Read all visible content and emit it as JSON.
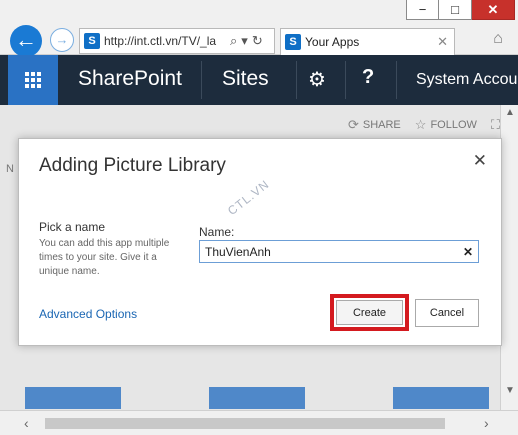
{
  "browser": {
    "address_url": "http://int.ctl.vn/TV/_la",
    "tab_title": "Your Apps",
    "window_min": "−",
    "window_max": "□",
    "window_close": "✕"
  },
  "suite_bar": {
    "brand": "SharePoint",
    "sites": "Sites",
    "help": "?",
    "account": "System Accou"
  },
  "page_actions": {
    "share": "SHARE",
    "follow": "FOLLOW"
  },
  "left_stub": "N",
  "dialog": {
    "title": "Adding Picture Library",
    "pick_label": "Pick a name",
    "pick_description": "You can add this app multiple times to your site. Give it a unique name.",
    "name_label": "Name:",
    "name_value": "ThuVienAnh",
    "watermark": "CTL.VN",
    "advanced_link": "Advanced Options",
    "create_label": "Create",
    "cancel_label": "Cancel"
  },
  "colors": {
    "suite_bg": "#1d2c3d",
    "waffle_bg": "#2a72c4",
    "highlight_outline": "#d41a1f",
    "link": "#1a66b3"
  }
}
